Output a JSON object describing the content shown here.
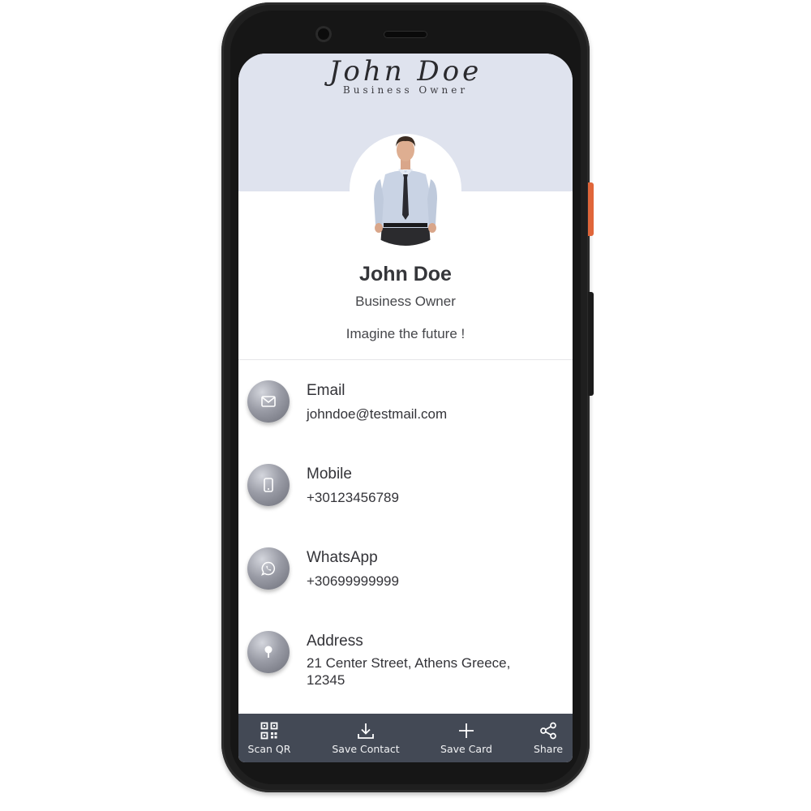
{
  "header": {
    "name": "John Doe",
    "role": "Business Owner"
  },
  "profile": {
    "name": "John Doe",
    "role": "Business Owner",
    "tagline": "Imagine the future !"
  },
  "contacts": [
    {
      "label": "Email",
      "value": "johndoe@testmail.com",
      "icon": "mail-icon"
    },
    {
      "label": "Mobile",
      "value": "+30123456789",
      "icon": "mobile-phone-icon"
    },
    {
      "label": "WhatsApp",
      "value": "+30699999999",
      "icon": "whatsapp-icon"
    },
    {
      "label": "Address",
      "value": "21 Center Street, Athens Greece, 12345",
      "icon": "map-pin-icon"
    }
  ],
  "bottom_bar": {
    "items": [
      {
        "label": "Scan QR",
        "icon": "qr-code-icon"
      },
      {
        "label": "Save Contact",
        "icon": "download-icon"
      },
      {
        "label": "Save Card",
        "icon": "plus-icon"
      },
      {
        "label": "Share",
        "icon": "share-icon"
      }
    ]
  },
  "colors": {
    "header_band": "#dfe3ee",
    "bottom_bar": "#434955",
    "power_button": "#e0663a",
    "text": "#35363a"
  }
}
